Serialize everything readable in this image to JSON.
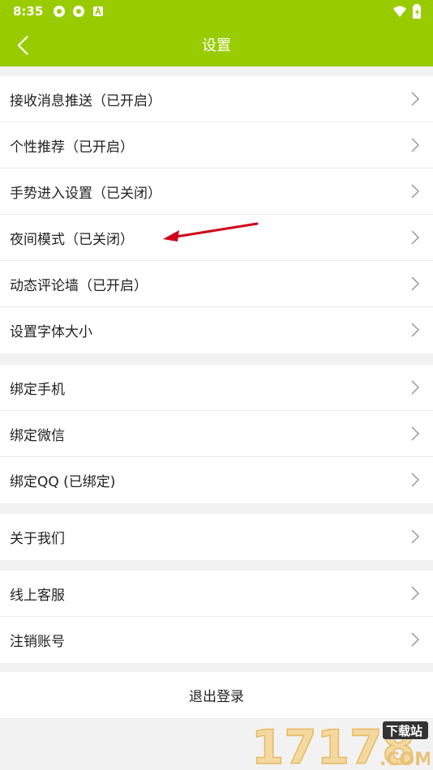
{
  "status": {
    "time": "8:35"
  },
  "header": {
    "title": "设置"
  },
  "groups": [
    {
      "items": [
        {
          "label": "接收消息推送（已开启）"
        },
        {
          "label": "个性推荐（已开启）"
        },
        {
          "label": "手势进入设置（已关闭）"
        },
        {
          "label": "夜间模式（已关闭）"
        },
        {
          "label": "动态评论墙（已开启）"
        },
        {
          "label": "设置字体大小"
        }
      ]
    },
    {
      "items": [
        {
          "label": "绑定手机"
        },
        {
          "label": "绑定微信"
        },
        {
          "label": "绑定QQ (已绑定)"
        }
      ]
    },
    {
      "items": [
        {
          "label": "关于我们"
        }
      ]
    },
    {
      "items": [
        {
          "label": "线上客服"
        },
        {
          "label": "注销账号"
        }
      ]
    }
  ],
  "logout_label": "退出登录",
  "watermark": {
    "main": "17178",
    "badge": "下载站",
    "suffix": ".COM"
  },
  "colors": {
    "accent": "#99cc00",
    "arrow": "#d0021b"
  },
  "icons": [
    "back-arrow-icon",
    "chevron-right-icon",
    "wifi-icon",
    "battery-icon"
  ]
}
